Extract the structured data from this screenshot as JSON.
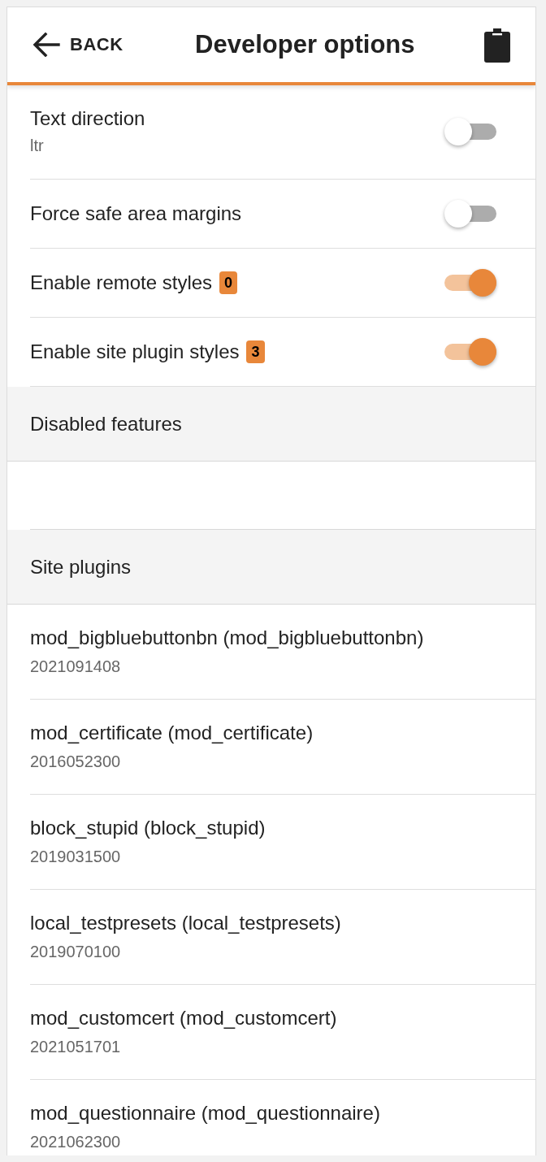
{
  "header": {
    "back_label": "BACK",
    "title": "Developer options"
  },
  "settings": [
    {
      "label": "Text direction",
      "value": "ltr",
      "on": false
    },
    {
      "label": "Force safe area margins",
      "on": false
    },
    {
      "label": "Enable remote styles",
      "badge": "0",
      "on": true
    },
    {
      "label": "Enable site plugin styles",
      "badge": "3",
      "on": true
    }
  ],
  "disabled_features": {
    "title": "Disabled features"
  },
  "site_plugins": {
    "title": "Site plugins",
    "items": [
      {
        "name": "mod_bigbluebuttonbn (mod_bigbluebuttonbn)",
        "version": "2021091408"
      },
      {
        "name": "mod_certificate (mod_certificate)",
        "version": "2016052300"
      },
      {
        "name": "block_stupid (block_stupid)",
        "version": "2019031500"
      },
      {
        "name": "local_testpresets (local_testpresets)",
        "version": "2019070100"
      },
      {
        "name": "mod_customcert (mod_customcert)",
        "version": "2021051701"
      },
      {
        "name": "mod_questionnaire (mod_questionnaire)",
        "version": "2021062300"
      }
    ]
  }
}
